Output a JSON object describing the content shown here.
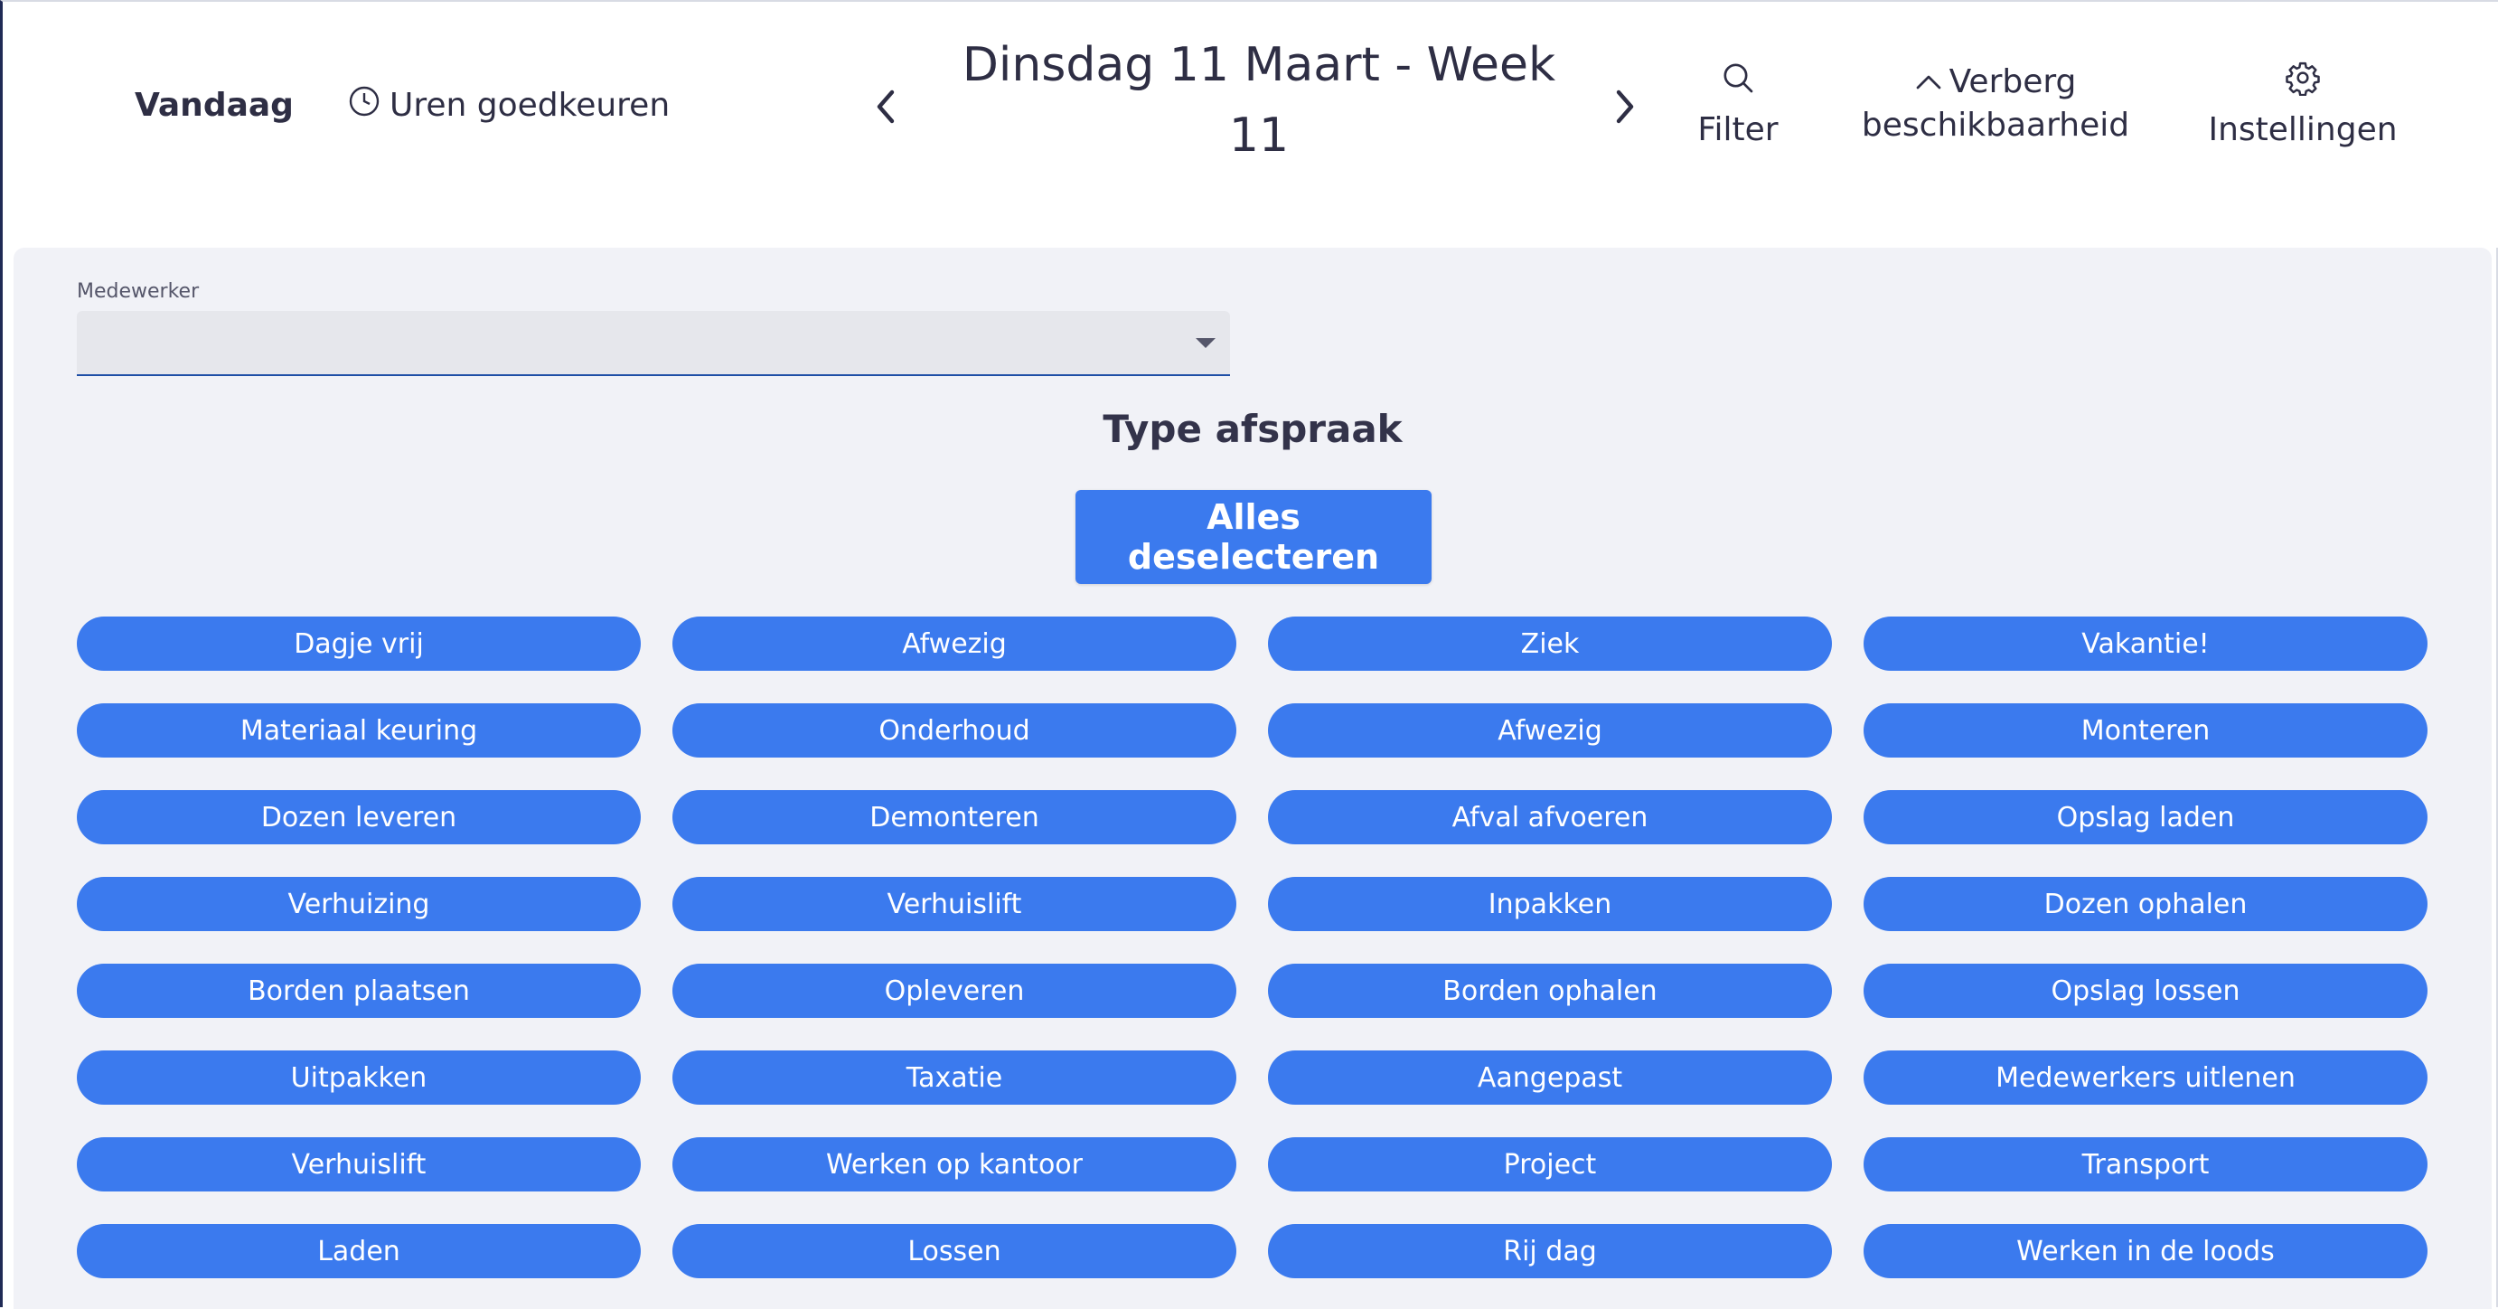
{
  "header": {
    "today_label": "Vandaag",
    "approve_hours_label": "Uren goedkeuren",
    "date_title_line1": "Dinsdag 11 Maart - Week",
    "date_title_line2": "11",
    "filter_label": "Filter",
    "availability_line1": "Verberg",
    "availability_line2": "beschikbaarheid",
    "settings_label": "Instellingen",
    "icons": {
      "approve": "clock-icon",
      "prev": "chevron-left-icon",
      "next": "chevron-right-icon",
      "filter": "search-icon",
      "availability": "chevron-up-icon",
      "settings": "gear-icon"
    }
  },
  "panel": {
    "employee_label": "Medewerker",
    "employee_value": "",
    "type_title": "Type afspraak",
    "deselect_label": "Alles deselecteren",
    "appointment_types": [
      "Dagje vrij",
      "Afwezig",
      "Ziek",
      "Vakantie!",
      "Materiaal keuring",
      "Onderhoud",
      "Afwezig",
      "Monteren",
      "Dozen leveren",
      "Demonteren",
      "Afval afvoeren",
      "Opslag laden",
      "Verhuizing",
      "Verhuislift",
      "Inpakken",
      "Dozen ophalen",
      "Borden plaatsen",
      "Opleveren",
      "Borden ophalen",
      "Opslag lossen",
      "Uitpakken",
      "Taxatie",
      "Aangepast",
      "Medewerkers uitlenen",
      "Verhuislift",
      "Werken op kantoor",
      "Project",
      "Transport",
      "Laden",
      "Lossen",
      "Rij dag",
      "Werken in de loods"
    ]
  },
  "colors": {
    "accent": "#3b7aee",
    "panel_bg": "#f1f2f7",
    "text": "#2e2e44"
  }
}
